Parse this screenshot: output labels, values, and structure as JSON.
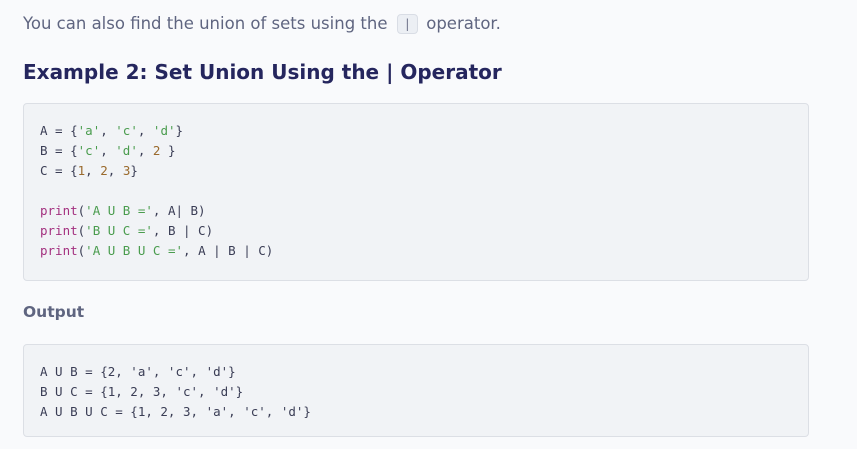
{
  "intro": {
    "before": "You can also find the union of sets using the ",
    "operator": "|",
    "after": " operator."
  },
  "heading": "Example 2: Set Union Using the | Operator",
  "code": {
    "line1": {
      "prefix": "A = {",
      "s1": "'a'",
      "c1": ", ",
      "s2": "'c'",
      "c2": ", ",
      "s3": "'d'",
      "end": "}"
    },
    "line2": {
      "prefix": "B = {",
      "s1": "'c'",
      "c1": ", ",
      "s2": "'d'",
      "c2": ", ",
      "n1": "2",
      "end": " }"
    },
    "line3": {
      "prefix": "C = {",
      "n1": "1",
      "c1": ", ",
      "n2": "2",
      "c2": ", ",
      "n3": "3",
      "end": "}"
    },
    "line4": {
      "fn": "print",
      "open": "(",
      "str": "'A U B ='",
      "rest": ", A| B)"
    },
    "line5": {
      "fn": "print",
      "open": "(",
      "str": "'B U C ='",
      "rest": ", B | C)"
    },
    "line6": {
      "fn": "print",
      "open": "(",
      "str": "'A U B U C ='",
      "rest": ", A | B | C)"
    }
  },
  "output_label": "Output",
  "output_lines": [
    "A U B = {2, 'a', 'c', 'd'}",
    "B U C = {1, 2, 3, 'c', 'd'}",
    "A U B U C = {1, 2, 3, 'a', 'c', 'd'}"
  ]
}
